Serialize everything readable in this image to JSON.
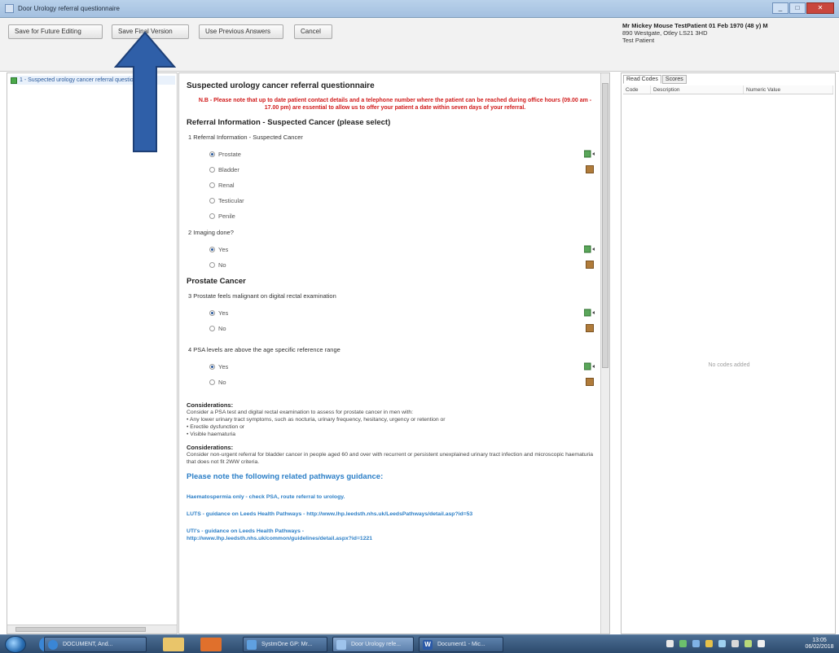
{
  "window": {
    "title": "Door Urology referral questionnaire"
  },
  "toolbar": {
    "save_future": "Save for Future Editing",
    "save_final": "Save Final Version",
    "use_previous": "Use Previous Answers",
    "cancel": "Cancel"
  },
  "patient": {
    "name_line": "Mr Mickey Mouse TestPatient 01 Feb 1970 (48 y) M",
    "address": "890 Westgate, Otley LS21 3HD",
    "note": "Test Patient"
  },
  "nav": {
    "item": "1 - Suspected urology cancer referral questionnaire"
  },
  "form": {
    "title": "Suspected urology cancer referral questionnaire",
    "warning": "N.B - Please note that up to date patient contact details and a telephone number where the patient can be reached during office hours (09.00 am - 17.00 pm) are essential to allow us to offer your patient a date within seven days of your referral.",
    "section1": "Referral Information - Suspected Cancer (please select)",
    "q1": "1  Referral Information - Suspected Cancer",
    "q1_options": [
      "Prostate",
      "Bladder",
      "Renal",
      "Testicular",
      "Penile"
    ],
    "q2": "2  Imaging done?",
    "q2_options": [
      "Yes",
      "No"
    ],
    "section2": "Prostate Cancer",
    "q3": "3  Prostate feels malignant on digital rectal examination",
    "q3_options": [
      "Yes",
      "No"
    ],
    "q4": "4  PSA levels are above the age specific reference range",
    "q4_options": [
      "Yes",
      "No"
    ],
    "considerations1_title": "Considerations:",
    "considerations1_lines": [
      "Consider a PSA test and digital rectal examination to assess for prostate cancer in men with:",
      "• Any lower urinary tract symptoms, such as nocturia, urinary frequency, hesitancy, urgency or retention or",
      "• Erectile dysfunction or",
      "• Visible haematuria"
    ],
    "considerations2_title": "Considerations:",
    "considerations2_text": "Consider non-urgent referral for bladder cancer in people aged 60 and over with recurrent or persistent unexplained urinary tract infection and microscopic haematuria that does not fit 2WW criteria.",
    "pathways_heading": "Please note the following related pathways guidance:",
    "links": [
      "Haematospermia only - check PSA, route referral to urology.",
      "LUTS - guidance on Leeds Health Pathways - http://www.lhp.leedsth.nhs.uk/LeedsPathways/detail.asp?id=53",
      "UTI's - guidance on Leeds Health Pathways -",
      "http://www.lhp.leedsth.nhs.uk/common/guidelines/detail.aspx?id=1221"
    ]
  },
  "right_panel": {
    "tabs": [
      "Read Codes",
      "Scores"
    ],
    "columns": [
      "Code",
      "Description",
      "Numeric Value"
    ],
    "empty_text": "No codes added"
  },
  "taskbar": {
    "tasks": [
      "DOCUMENT, And...",
      "SystmOne GP: Mr...",
      "Door Urology refe...",
      "Document1 - Mic..."
    ],
    "clock_time": "13:05",
    "clock_date": "06/02/2018"
  }
}
